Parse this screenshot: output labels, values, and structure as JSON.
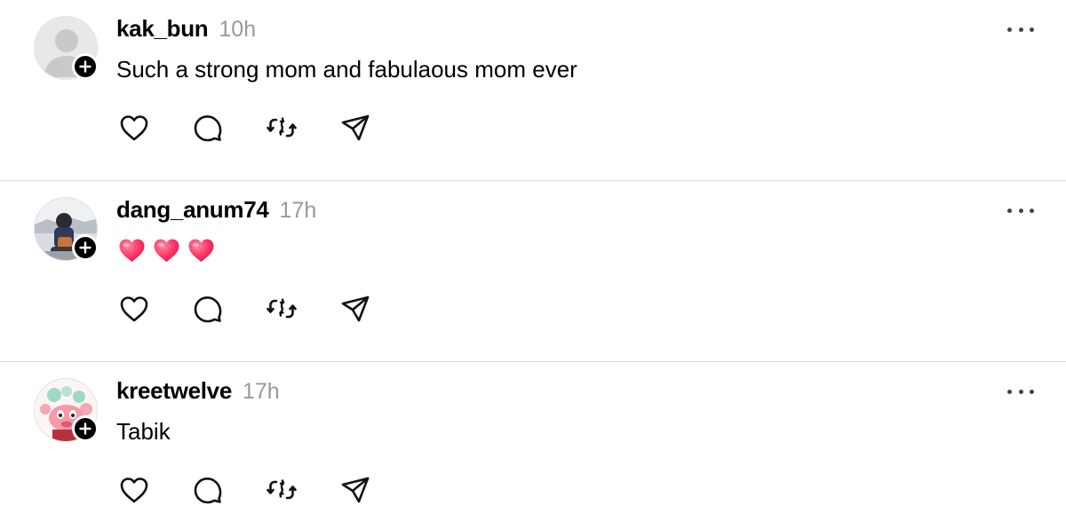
{
  "posts": [
    {
      "username": "kak_bun",
      "time": "10h",
      "text": "Such a strong mom and fabulaous mom ever",
      "avatar": "default-avatar",
      "emojis": []
    },
    {
      "username": "dang_anum74",
      "time": "17h",
      "text": "",
      "avatar": "photo-avatar",
      "emojis": [
        "heart-emoji",
        "heart-emoji",
        "heart-emoji"
      ]
    },
    {
      "username": "kreetwelve",
      "time": "17h",
      "text": "Tabik",
      "avatar": "cartoon-avatar",
      "emojis": []
    }
  ],
  "icons": {
    "like": "heart-outline-icon",
    "comment": "comment-bubble-icon",
    "repost": "repost-arrows-icon",
    "share": "send-paper-plane-icon",
    "more": "more-horizontal-icon",
    "follow": "plus-icon"
  },
  "colors": {
    "text": "#000000",
    "muted": "#999999",
    "divider": "#dbdbdb",
    "heart": "#ff3b6b"
  }
}
